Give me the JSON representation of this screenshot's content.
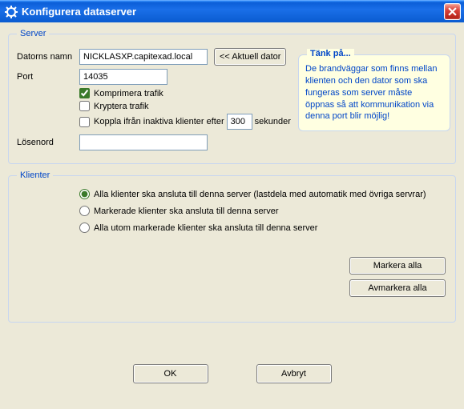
{
  "window": {
    "title": "Konfigurera dataserver"
  },
  "server": {
    "legend": "Server",
    "computerNameLabel": "Datorns namn",
    "computerName": "NICKLASXP.capitexad.local",
    "currentComputerBtn": "<< Aktuell dator",
    "portLabel": "Port",
    "port": "14035",
    "compress": {
      "label": "Komprimera trafik",
      "checked": true
    },
    "encrypt": {
      "label": "Kryptera trafik",
      "checked": false
    },
    "disconnect": {
      "prefix": "Koppla ifrån inaktiva klienter efter",
      "value": "300",
      "suffix": "sekunder",
      "checked": false
    },
    "passwordLabel": "Lösenord",
    "password": ""
  },
  "hint": {
    "legend": "Tänk på...",
    "text": "De brandväggar som finns mellan klienten och den dator som ska fungeras som server måste öppnas så att kommunikation via denna port blir möjlig!"
  },
  "klienter": {
    "legend": "Klienter",
    "options": {
      "all": "Alla klienter ska ansluta till denna server (lastdela med automatik med övriga servrar)",
      "marked": "Markerade klienter ska ansluta till denna server",
      "except": "Alla utom markerade klienter ska ansluta till denna server"
    },
    "selected": "all",
    "markAll": "Markera alla",
    "unmarkAll": "Avmarkera alla"
  },
  "footer": {
    "ok": "OK",
    "cancel": "Avbryt"
  }
}
